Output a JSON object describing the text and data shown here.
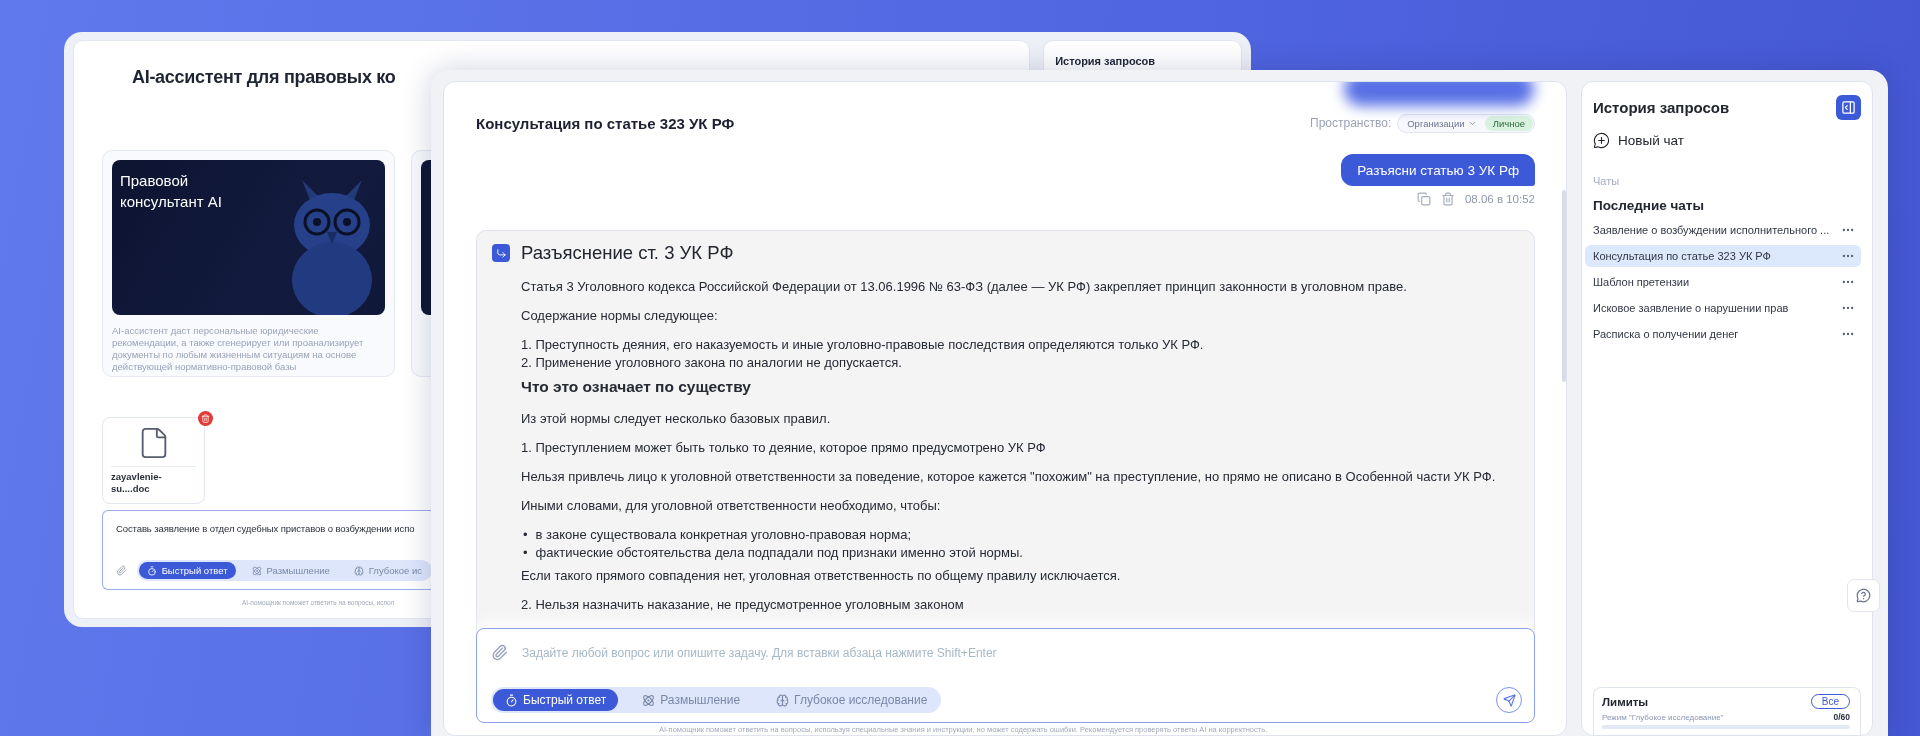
{
  "back_window": {
    "title": "AI-ассистент для правовых ко",
    "feature_card": {
      "title_lines": [
        "Правовой",
        "консультант AI"
      ],
      "description": "AI-ассистент даст персональные юридические рекомендации, а также сгенерирует или проанализирует документы по любым жизненным ситуациям на основе действующей нормативно-правовой базы"
    },
    "attachment": {
      "file_name": "zayavlenie-su....doc"
    },
    "composer": {
      "value": "Составь заявление в отдел судебных приставов о возбуждении испо",
      "modes": [
        {
          "kind": "fast",
          "label": "Быстрый ответ",
          "selected": true
        },
        {
          "kind": "thinking",
          "label": "Размышление",
          "selected": false
        },
        {
          "kind": "research",
          "label": "Глубокое ис",
          "selected": false
        }
      ]
    },
    "footer": "AI-помощник поможет ответить на вопросы, испол",
    "sidebar_title": "История запросов"
  },
  "chat": {
    "title": "Консультация по статье 323 УК РФ",
    "space": {
      "label": "Пространство:",
      "options": [
        {
          "kind": "dropdown",
          "label": "Организации",
          "selected": false
        },
        {
          "kind": "plain",
          "label": "Личное",
          "selected": true
        }
      ]
    },
    "user_message": {
      "text": "Разъясни статью 3 УК Рф",
      "time": "08.06 в 10:52"
    },
    "answer": {
      "title": "Разъяснение ст. 3 УК РФ",
      "blocks": [
        {
          "kind": "paragraph",
          "text": "Статья 3 Уголовного кодекса Российской Федерации от 13.06.1996 № 63-ФЗ (далее — УК РФ) закрепляет принцип законности в уголовном праве."
        },
        {
          "kind": "paragraph",
          "text": "Содержание нормы следующее:"
        },
        {
          "kind": "lines",
          "items": [
            "1. Преступность деяния, его наказуемость и иные уголовно-правовые последствия определяются только УК РФ.",
            "2. Применение уголовного закона по аналогии не допускается."
          ]
        },
        {
          "kind": "heading",
          "text": "Что это означает по существу"
        },
        {
          "kind": "paragraph",
          "text": "Из этой нормы следует несколько базовых правил."
        },
        {
          "kind": "paragraph",
          "text": "1. Преступлением может быть только то деяние, которое прямо предусмотрено УК РФ"
        },
        {
          "kind": "paragraph",
          "text": "Нельзя привлечь лицо к уголовной ответственности за поведение, которое кажется \"похожим\" на преступление, но прямо не описано в Особенной части УК РФ."
        },
        {
          "kind": "paragraph",
          "text": "Иными словами, для уголовной ответственности необходимо, чтобы:"
        },
        {
          "kind": "bullets",
          "items": [
            {
              "marker": "•",
              "text": "в законе существовала конкретная уголовно-правовая норма;"
            },
            {
              "marker": "•",
              "text": "фактические обстоятельства дела подпадали под признаки именно этой нормы."
            }
          ]
        },
        {
          "kind": "paragraph",
          "text": "Если такого прямого совпадения нет, уголовная ответственность по общему правилу исключается."
        },
        {
          "kind": "paragraph",
          "text": "2. Нельзя назначить наказание, не предусмотренное уголовным законом"
        }
      ]
    },
    "composer": {
      "placeholder": "Задайте любой вопрос или опишите задачу. Для вставки абзаца нажмите Shift+Enter",
      "modes": [
        {
          "kind": "fast",
          "label": "Быстрый ответ",
          "selected": true
        },
        {
          "kind": "thinking",
          "label": "Размышление",
          "selected": false
        },
        {
          "kind": "research",
          "label": "Глубокое исследование",
          "selected": false
        }
      ]
    },
    "footer": "AI-помощник поможет ответить на вопросы, используя специальные знания и инструкции, но может содержать ошибки. Рекомендуется проверять ответы AI на корректность."
  },
  "sidebar": {
    "title": "История запросов",
    "new_chat": "Новый чат",
    "section": "Чаты",
    "group": "Последние чаты",
    "items": [
      {
        "label": "Заявление о возбуждении исполнительного ...",
        "selected": false
      },
      {
        "label": "Консультация по статье 323 УК РФ",
        "selected": true
      },
      {
        "label": "Шаблон претензии",
        "selected": false
      },
      {
        "label": "Исковое заявление о нарушении прав",
        "selected": false
      },
      {
        "label": "Расписка о получении денег",
        "selected": false
      }
    ],
    "limits": {
      "title": "Лимиты",
      "button": "Все",
      "mode": "Режим \"Глубокое исследование\"",
      "count": "0/60",
      "level": 0
    }
  }
}
